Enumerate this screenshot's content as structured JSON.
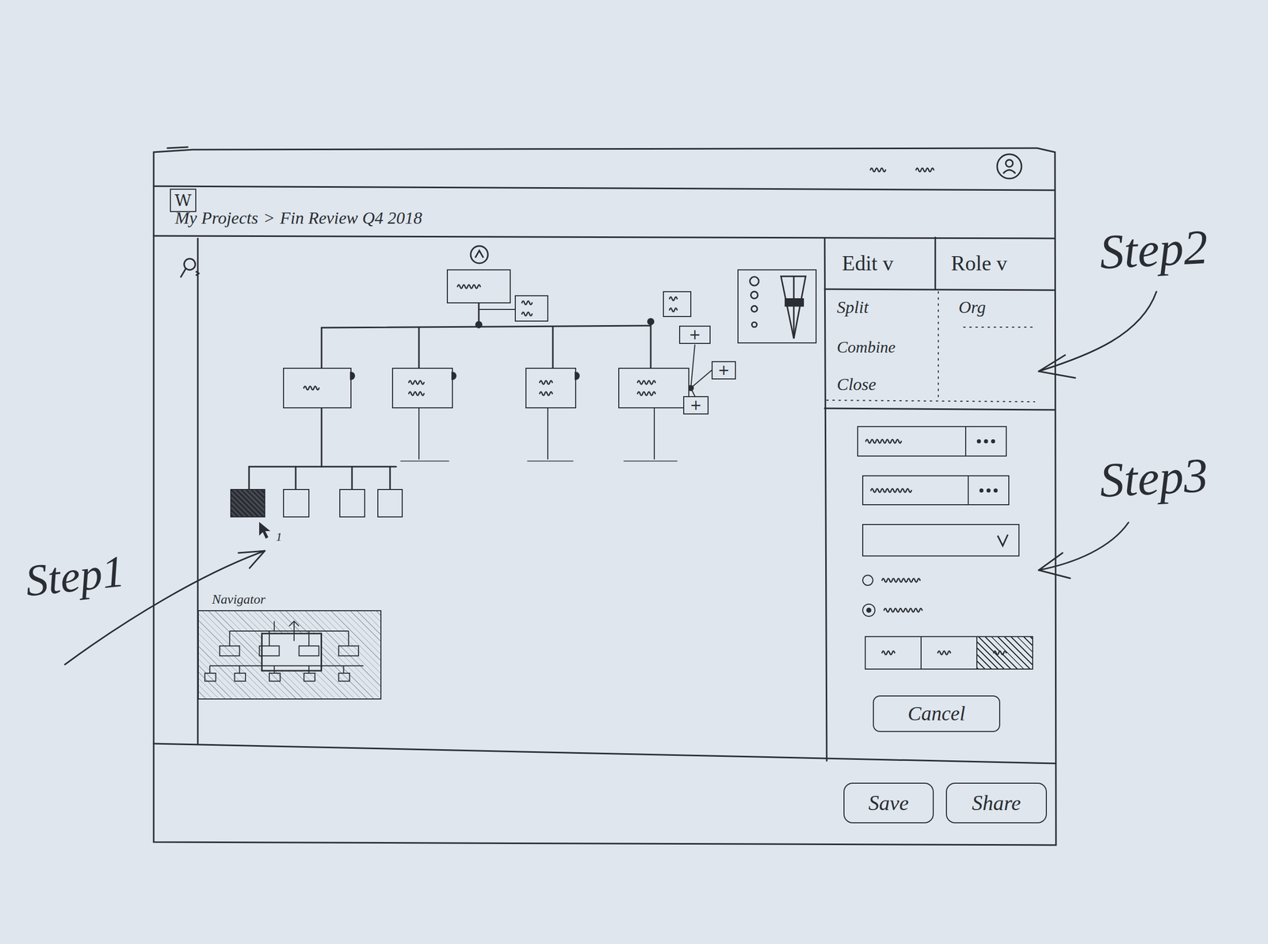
{
  "steps": [
    "Step1",
    "Step2",
    "Step3"
  ],
  "app": {
    "logo": "W",
    "breadcrumb": [
      "My Projects",
      "Fin Review Q4 2018"
    ],
    "breadcrumb_separator": ">"
  },
  "menus": [
    {
      "label": "Edit v",
      "items": [
        "Split",
        "Combine",
        "Close"
      ]
    },
    {
      "label": "Role v",
      "items": [
        "Org"
      ]
    }
  ],
  "chart": {
    "grandchildren": [
      {
        "selected": true
      },
      {
        "selected": false
      },
      {
        "selected": false
      },
      {
        "selected": false
      }
    ],
    "add_buttons": [
      "+",
      "+",
      "+"
    ],
    "cursor_badge": "1"
  },
  "navigator": {
    "label": "Navigator"
  },
  "form": {
    "radios": [
      {
        "selected": false
      },
      {
        "selected": true
      }
    ],
    "segments": [
      {
        "selected": false
      },
      {
        "selected": false
      },
      {
        "selected": true
      }
    ],
    "cancel": "Cancel"
  },
  "buttons": [
    "Save",
    "Share"
  ]
}
